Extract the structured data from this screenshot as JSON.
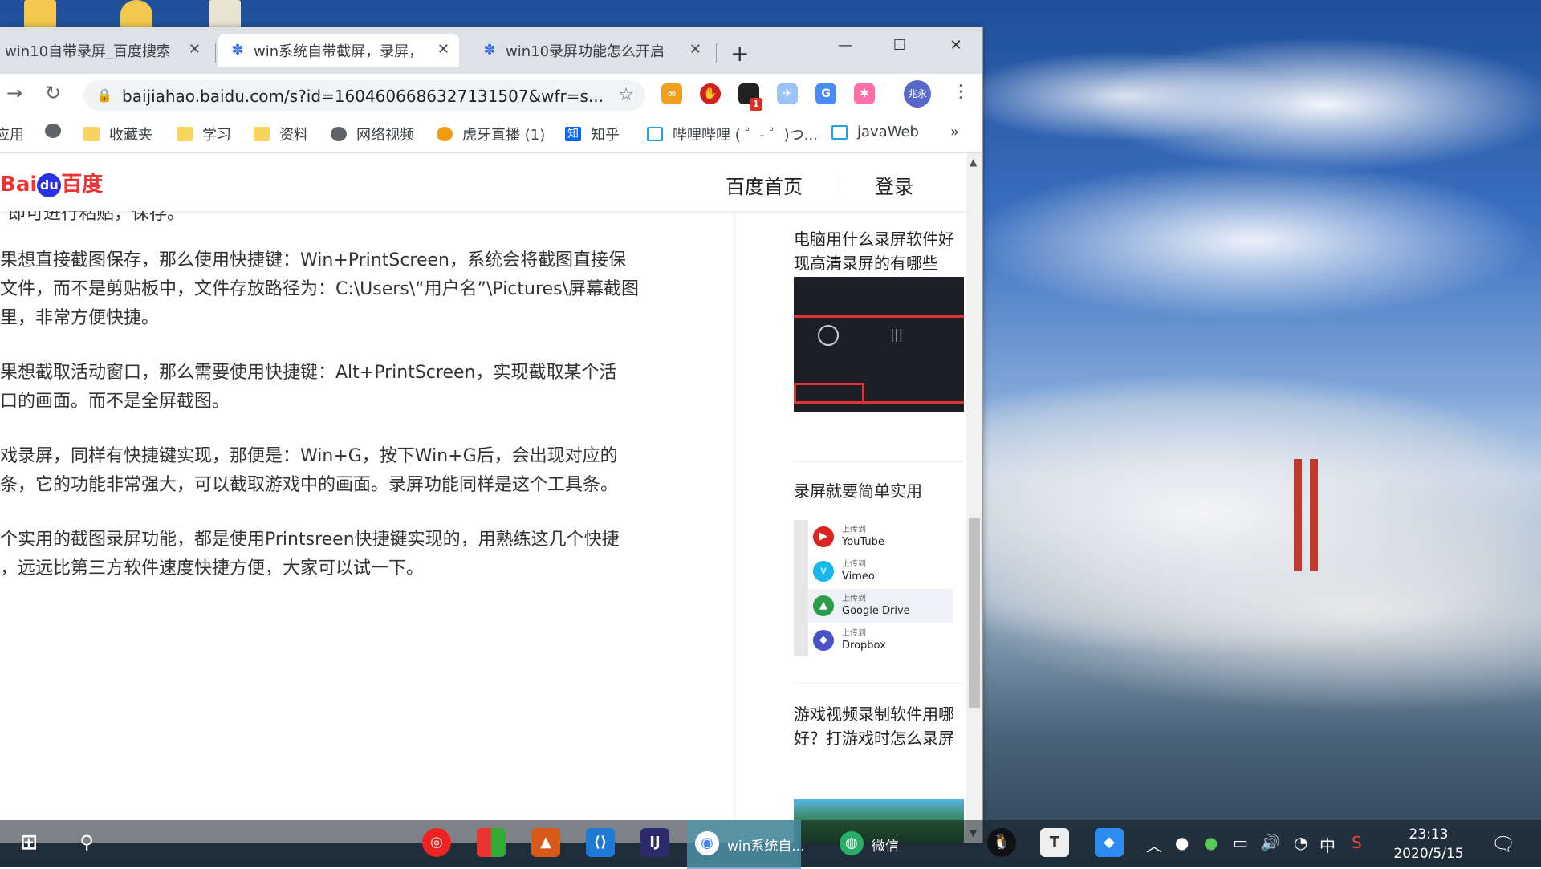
{
  "browser": {
    "tabs": [
      {
        "title": "win10自带录屏_百度搜索",
        "active": false
      },
      {
        "title": "win系统自带截屏，录屏，",
        "active": true
      },
      {
        "title": "win10录屏功能怎么开启",
        "active": false
      }
    ],
    "close_glyph": "✕",
    "new_tab_glyph": "+",
    "window_controls": {
      "minimize": "—",
      "maximize": "☐",
      "close": "✕"
    },
    "url": "baijiahao.baidu.com/s?id=1604606686327131507&wfr=s...",
    "profile_label": "兆永",
    "extension_badge": "1"
  },
  "bookmarks": [
    {
      "label": "应用",
      "icon": "apps-icon"
    },
    {
      "label": "",
      "icon": "globe-icon"
    },
    {
      "label": "收藏夹",
      "icon": "folder-icon"
    },
    {
      "label": "学习",
      "icon": "folder-icon"
    },
    {
      "label": "资料",
      "icon": "folder-icon"
    },
    {
      "label": "网络视频",
      "icon": "globe-icon"
    },
    {
      "label": "虎牙直播 (1)",
      "icon": "huya-icon"
    },
    {
      "label": "知乎",
      "icon": "zhihu-icon"
    },
    {
      "label": "哔哩哔哩 ( ゜- ゜)つ...",
      "icon": "bilibili-icon"
    },
    {
      "label": "javaWeb",
      "icon": "bilibili-icon"
    }
  ],
  "bookmarks_overflow": "»",
  "site": {
    "logo_text_1": "Bai",
    "logo_text_du": "du",
    "logo_text_2": "百度",
    "nav_home": "百度首页",
    "nav_login": "登录"
  },
  "article": {
    "paragraphs": [
      [
        "即可进行粘贴，保存。"
      ],
      [
        "果想直接截图保存，那么使用快捷键：Win+PrintScreen，系统会将截图直接保",
        "文件，而不是剪贴板中，文件存放路径为：C:\\Users\\“用户名”\\Pictures\\屏幕截图",
        "里，非常方便快捷。"
      ],
      [
        "果想截取活动窗口，那么需要使用快捷键：Alt+PrintScreen，实现截取某个活",
        "口的画面。而不是全屏截图。"
      ],
      [
        "戏录屏，同样有快捷键实现，那便是：Win+G，按下Win+G后，会出现对应的",
        "条，它的功能非常强大，可以截取游戏中的画面。录屏功能同样是这个工具条。"
      ],
      [
        "个实用的截图录屏功能，都是使用Printsreen快捷键实现的，用熟练这几个快捷",
        "，远远比第三方软件速度快捷方便，大家可以试一下。"
      ]
    ]
  },
  "sidebar": {
    "rec1_title": [
      "电脑用什么录屏软件好",
      "现高清录屏的有哪些"
    ],
    "rec2_title": "录屏就要简单实用",
    "upload_rows": [
      {
        "small": "上传到",
        "name": "YouTube"
      },
      {
        "small": "上传到",
        "name": "Vimeo"
      },
      {
        "small": "上传到",
        "name": "Google Drive"
      },
      {
        "small": "上传到",
        "name": "Dropbox"
      }
    ],
    "rec3_title": [
      "游戏视频录制软件用哪",
      "好？打游戏时怎么录屏"
    ]
  },
  "taskbar": {
    "chrome_label": "win系统自...",
    "wechat_label": "微信",
    "tray_ime": "中",
    "clock_time": "23:13",
    "clock_date": "2020/5/15"
  },
  "colors": {
    "baidu_red": "#e33333",
    "baidu_blue": "#2932e1",
    "tab_strip": "#dee1e6",
    "taskbar": "#141c24"
  }
}
